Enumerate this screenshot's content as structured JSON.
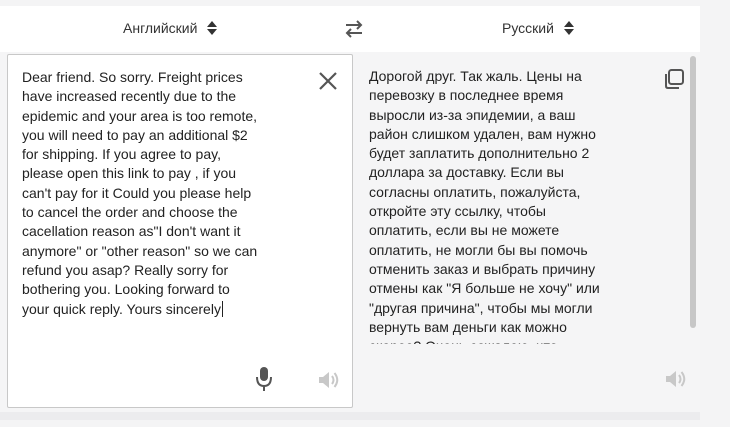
{
  "languages": {
    "source": "Английский",
    "target": "Русский"
  },
  "source": {
    "text": "Dear friend. So sorry. Freight prices\nhave increased recently due to the\nepidemic and your area is too remote,\nyou will need to pay an additional $2\nfor shipping. If you agree to pay,\nplease open this link to pay , if you\ncan't pay for it Could you please help\nto cancel the order and choose the\ncacellation reason as\"I don't want it\nanymore\" or \"other reason\" so we can\nrefund you asap? Really sorry for\nbothering you. Looking forward to\nyour quick reply. Yours sincerely"
  },
  "target": {
    "text": "Дорогой друг. Так жаль. Цены на\nперевозку в последнее время\nвыросли из-за эпидемии, а ваш\nрайон слишком удален, вам нужно\nбудет заплатить дополнительно 2\nдоллара за доставку. Если вы\nсогласны оплатить, пожалуйста,\nоткройте эту ссылку, чтобы\nоплатить, если вы не можете\nоплатить, не могли бы вы помочь\nотменить заказ и выбрать причину\nотмены как \"Я больше не хочу\" или\n\"другая причина\", чтобы мы могли\nвернуть вам деньги как можно\nскорее? Очень сожалею, что\nпобеспокоил вас. С нетерпением"
  },
  "icons": {
    "swap": "swap-arrows-icon",
    "clear": "close-icon",
    "mic": "microphone-icon",
    "speaker": "speaker-icon",
    "copy": "copy-icon"
  }
}
